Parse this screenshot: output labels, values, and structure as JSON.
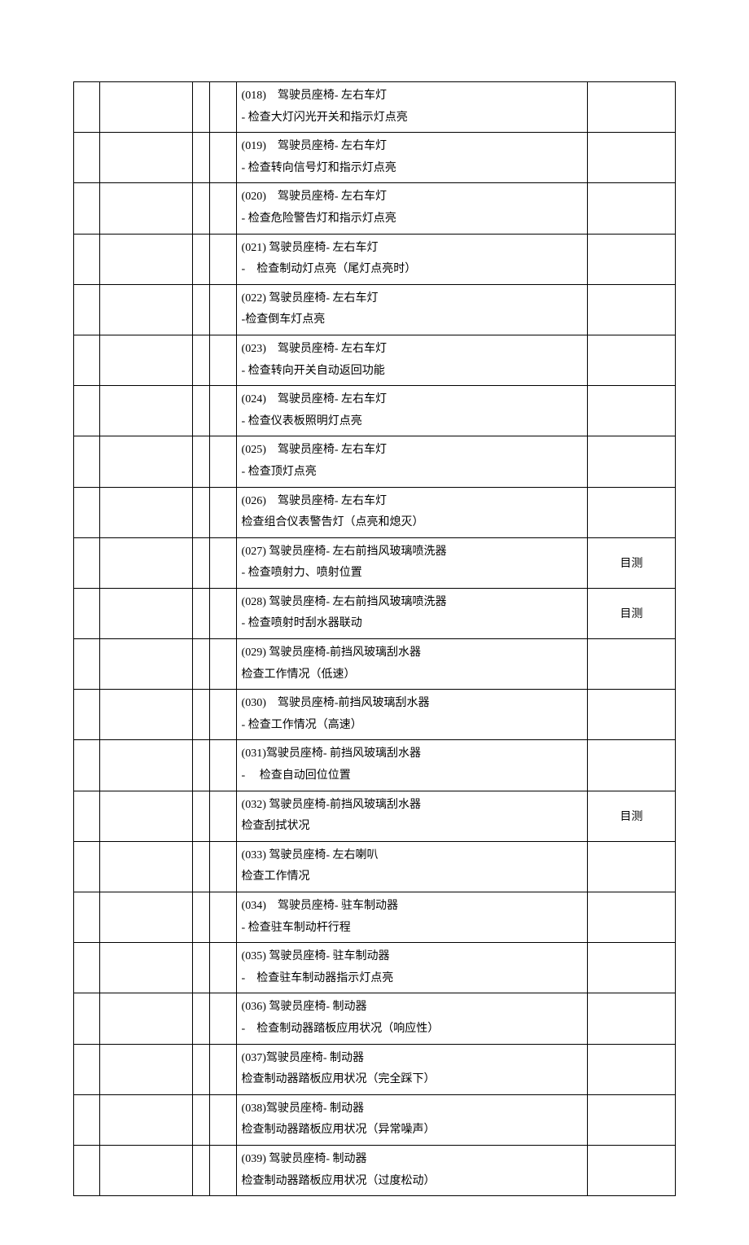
{
  "rows": [
    {
      "line1": "(018)　驾驶员座椅- 左右车灯",
      "line2": "- 检查大灯闪光开关和指示灯点亮",
      "method": ""
    },
    {
      "line1": "(019)　驾驶员座椅- 左右车灯",
      "line2": "- 检查转向信号灯和指示灯点亮",
      "method": ""
    },
    {
      "line1": "(020)　驾驶员座椅- 左右车灯",
      "line2": "- 检查危险警告灯和指示灯点亮",
      "method": ""
    },
    {
      "line1": "(021) 驾驶员座椅- 左右车灯",
      "line2": "-　检查制动灯点亮（尾灯点亮时）",
      "method": ""
    },
    {
      "line1": "(022) 驾驶员座椅- 左右车灯",
      "line2": "-检查倒车灯点亮",
      "method": ""
    },
    {
      "line1": "(023)　驾驶员座椅- 左右车灯",
      "line2": "- 检查转向开关自动返回功能",
      "method": ""
    },
    {
      "line1": "(024)　驾驶员座椅- 左右车灯",
      "line2": "- 检查仪表板照明灯点亮",
      "method": ""
    },
    {
      "line1": "(025)　驾驶员座椅- 左右车灯",
      "line2": "- 检查顶灯点亮",
      "method": ""
    },
    {
      "line1": "(026)　驾驶员座椅- 左右车灯",
      "line2": "检查组合仪表警告灯（点亮和熄灭）",
      "method": ""
    },
    {
      "line1": "(027) 驾驶员座椅- 左右前挡风玻璃喷洗器",
      "line2": "- 检查喷射力、喷射位置",
      "method": "目测"
    },
    {
      "line1": "(028) 驾驶员座椅- 左右前挡风玻璃喷洗器",
      "line2": "- 检查喷射时刮水器联动",
      "method": "目测"
    },
    {
      "line1": "(029) 驾驶员座椅-前挡风玻璃刮水器",
      "line2": "检查工作情况（低速）",
      "method": ""
    },
    {
      "line1": "(030)　驾驶员座椅-前挡风玻璃刮水器",
      "line2": "- 检查工作情况（高速）",
      "method": ""
    },
    {
      "line1": "(031)驾驶员座椅- 前挡风玻璃刮水器",
      "line2": "-　 检查自动回位位置",
      "method": ""
    },
    {
      "line1": "(032) 驾驶员座椅-前挡风玻璃刮水器",
      "line2": "检查刮拭状况",
      "method": "目测"
    },
    {
      "line1": "(033) 驾驶员座椅- 左右喇叭",
      "line2": "检查工作情况",
      "method": ""
    },
    {
      "line1": "(034)　驾驶员座椅- 驻车制动器",
      "line2": "- 检查驻车制动杆行程",
      "method": ""
    },
    {
      "line1": "(035) 驾驶员座椅- 驻车制动器",
      "line2": "-　检查驻车制动器指示灯点亮",
      "method": ""
    },
    {
      "line1": "(036) 驾驶员座椅- 制动器",
      "line2": "-　检查制动器踏板应用状况（响应性）",
      "method": ""
    },
    {
      "line1": "(037)驾驶员座椅- 制动器",
      "line2": "检查制动器踏板应用状况（完全踩下）",
      "method": ""
    },
    {
      "line1": "(038)驾驶员座椅- 制动器",
      "line2": "检查制动器踏板应用状况（异常噪声）",
      "method": ""
    },
    {
      "line1": "(039) 驾驶员座椅- 制动器",
      "line2": "检查制动器踏板应用状况（过度松动）",
      "method": ""
    }
  ]
}
